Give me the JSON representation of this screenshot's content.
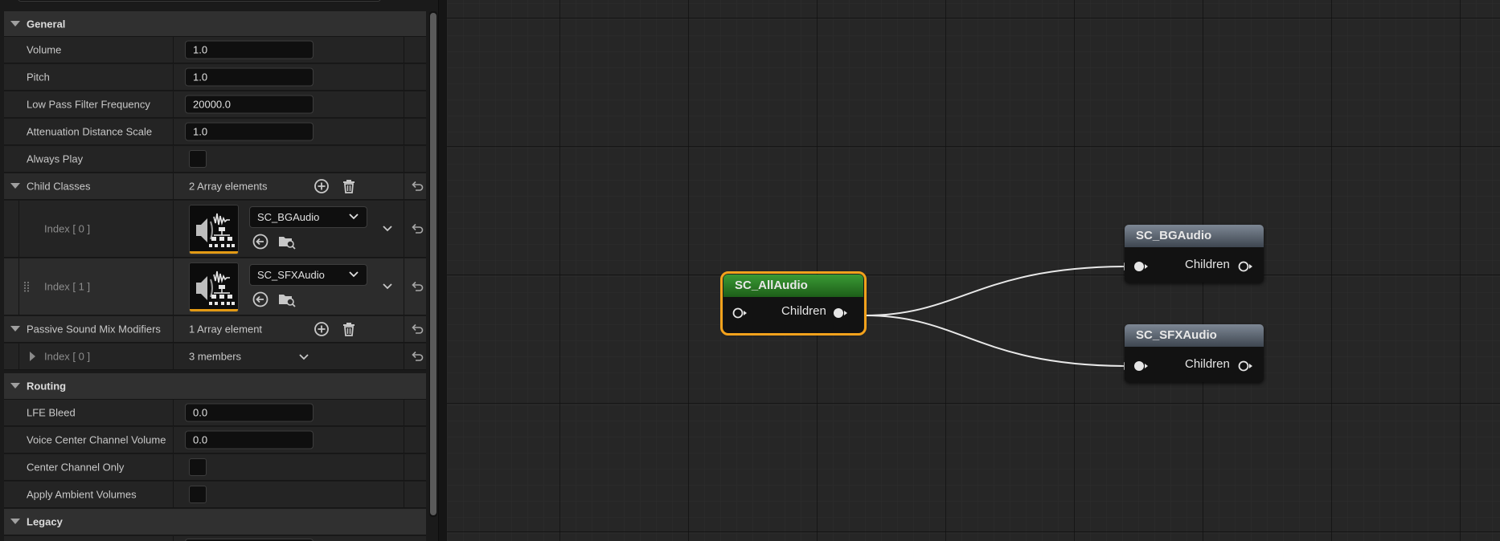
{
  "details": {
    "categories": {
      "general": "General",
      "routing": "Routing",
      "legacy": "Legacy"
    },
    "general": {
      "volume_label": "Volume",
      "volume_value": "1.0",
      "pitch_label": "Pitch",
      "pitch_value": "1.0",
      "lpf_label": "Low Pass Filter Frequency",
      "lpf_value": "20000.0",
      "attenuation_label": "Attenuation Distance Scale",
      "attenuation_value": "1.0",
      "always_play_label": "Always Play",
      "always_play_checked": false
    },
    "child_classes": {
      "label": "Child Classes",
      "count_text": "2 Array elements",
      "items": [
        {
          "index_label": "Index [ 0 ]",
          "asset": "SC_BGAudio"
        },
        {
          "index_label": "Index [ 1 ]",
          "asset": "SC_SFXAudio"
        }
      ]
    },
    "passive_mix": {
      "label": "Passive Sound Mix Modifiers",
      "count_text": "1 Array element",
      "items": [
        {
          "index_label": "Index [ 0 ]",
          "members_text": "3 members"
        }
      ]
    },
    "routing": {
      "lfe_label": "LFE Bleed",
      "lfe_value": "0.0",
      "vccv_label": "Voice Center Channel Volume",
      "vccv_value": "0.0",
      "cco_label": "Center Channel Only",
      "cco_checked": false,
      "aav_label": "Apply Ambient Volumes",
      "aav_checked": false
    }
  },
  "graph": {
    "nodes": [
      {
        "title": "SC_AllAudio",
        "pin_label": "Children",
        "selected": true,
        "header_color": "#2f8a2a"
      },
      {
        "title": "SC_BGAudio",
        "pin_label": "Children",
        "selected": false,
        "header_color": "#5d6773"
      },
      {
        "title": "SC_SFXAudio",
        "pin_label": "Children",
        "selected": false,
        "header_color": "#5d6773"
      }
    ],
    "connections": [
      {
        "from": "SC_AllAudio",
        "to": "SC_BGAudio"
      },
      {
        "from": "SC_AllAudio",
        "to": "SC_SFXAudio"
      }
    ],
    "selection_color": "#f3a21c"
  },
  "icons": {
    "add": "add-element-icon",
    "delete": "delete-icon",
    "reset": "reset-to-default-icon",
    "browse": "browse-to-asset-icon",
    "use_selected": "use-selected-asset-icon",
    "sound_class_thumb": "sound-class-thumbnail-icon"
  }
}
